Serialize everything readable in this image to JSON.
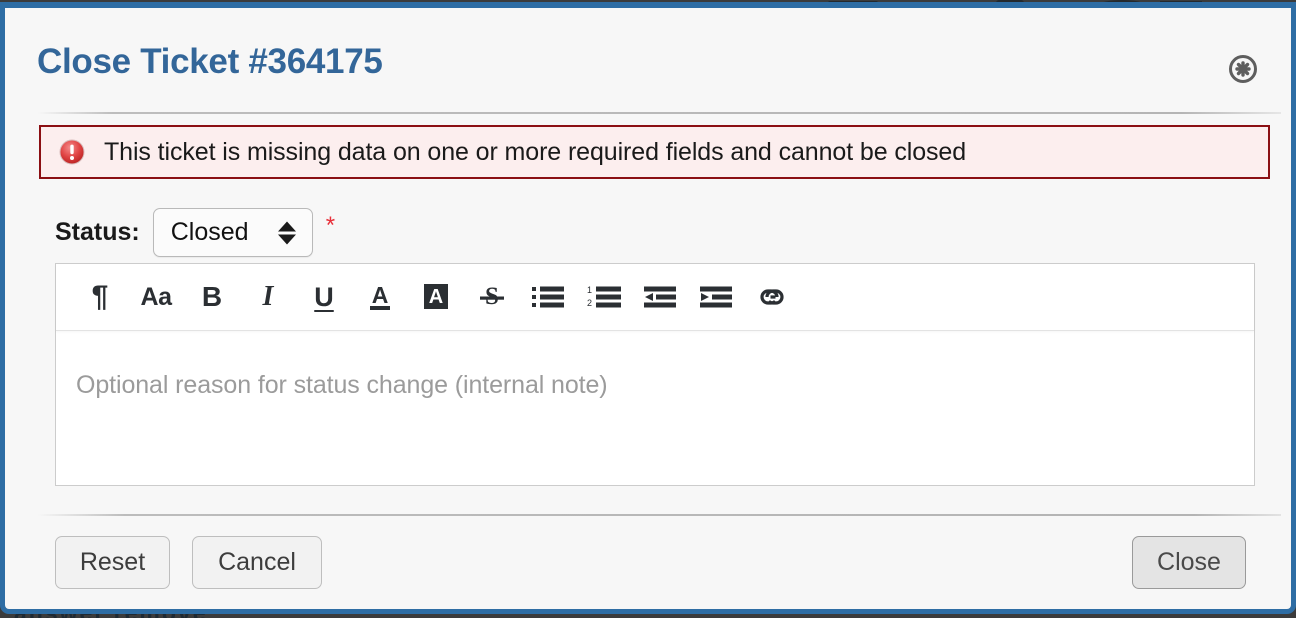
{
  "background": {
    "bottom_text": "answer     remove"
  },
  "dialog": {
    "title": "Close Ticket #364175",
    "close_icon": "close-circle-icon",
    "alert": {
      "icon": "error-exclamation-icon",
      "message": "This ticket is missing data on one or more required fields and cannot be closed",
      "border_color": "#8b0f13",
      "background_color": "#fceeee"
    },
    "status_field": {
      "label": "Status:",
      "value": "Closed",
      "options": [
        "Closed"
      ],
      "required_marker": "*",
      "required_color": "#e8303a"
    },
    "editor": {
      "placeholder": "Optional reason for status change (internal note)",
      "value": "",
      "toolbar": [
        {
          "name": "paragraph-format-icon",
          "glyph": "¶",
          "kind": "pilcrow"
        },
        {
          "name": "font-size-icon",
          "glyph": "Aa",
          "kind": "aa"
        },
        {
          "name": "bold-icon",
          "glyph": "B",
          "kind": "bold"
        },
        {
          "name": "italic-icon",
          "glyph": "I",
          "kind": "italic"
        },
        {
          "name": "underline-icon",
          "glyph": "U",
          "kind": "underline"
        },
        {
          "name": "text-color-icon",
          "glyph": "A",
          "kind": "svg-textcolor"
        },
        {
          "name": "highlight-color-icon",
          "glyph": "A",
          "kind": "svg-highlight"
        },
        {
          "name": "strikethrough-icon",
          "glyph": "S",
          "kind": "svg-strike"
        },
        {
          "name": "bulleted-list-icon",
          "glyph": "",
          "kind": "svg-ul"
        },
        {
          "name": "numbered-list-icon",
          "glyph": "",
          "kind": "svg-ol"
        },
        {
          "name": "outdent-icon",
          "glyph": "",
          "kind": "svg-outdent"
        },
        {
          "name": "indent-icon",
          "glyph": "",
          "kind": "svg-indent"
        },
        {
          "name": "insert-link-icon",
          "glyph": "",
          "kind": "svg-link"
        }
      ]
    },
    "footer": {
      "reset_label": "Reset",
      "cancel_label": "Cancel",
      "close_label": "Close"
    },
    "accent_color": "#2e6da4",
    "title_color": "#336699"
  }
}
